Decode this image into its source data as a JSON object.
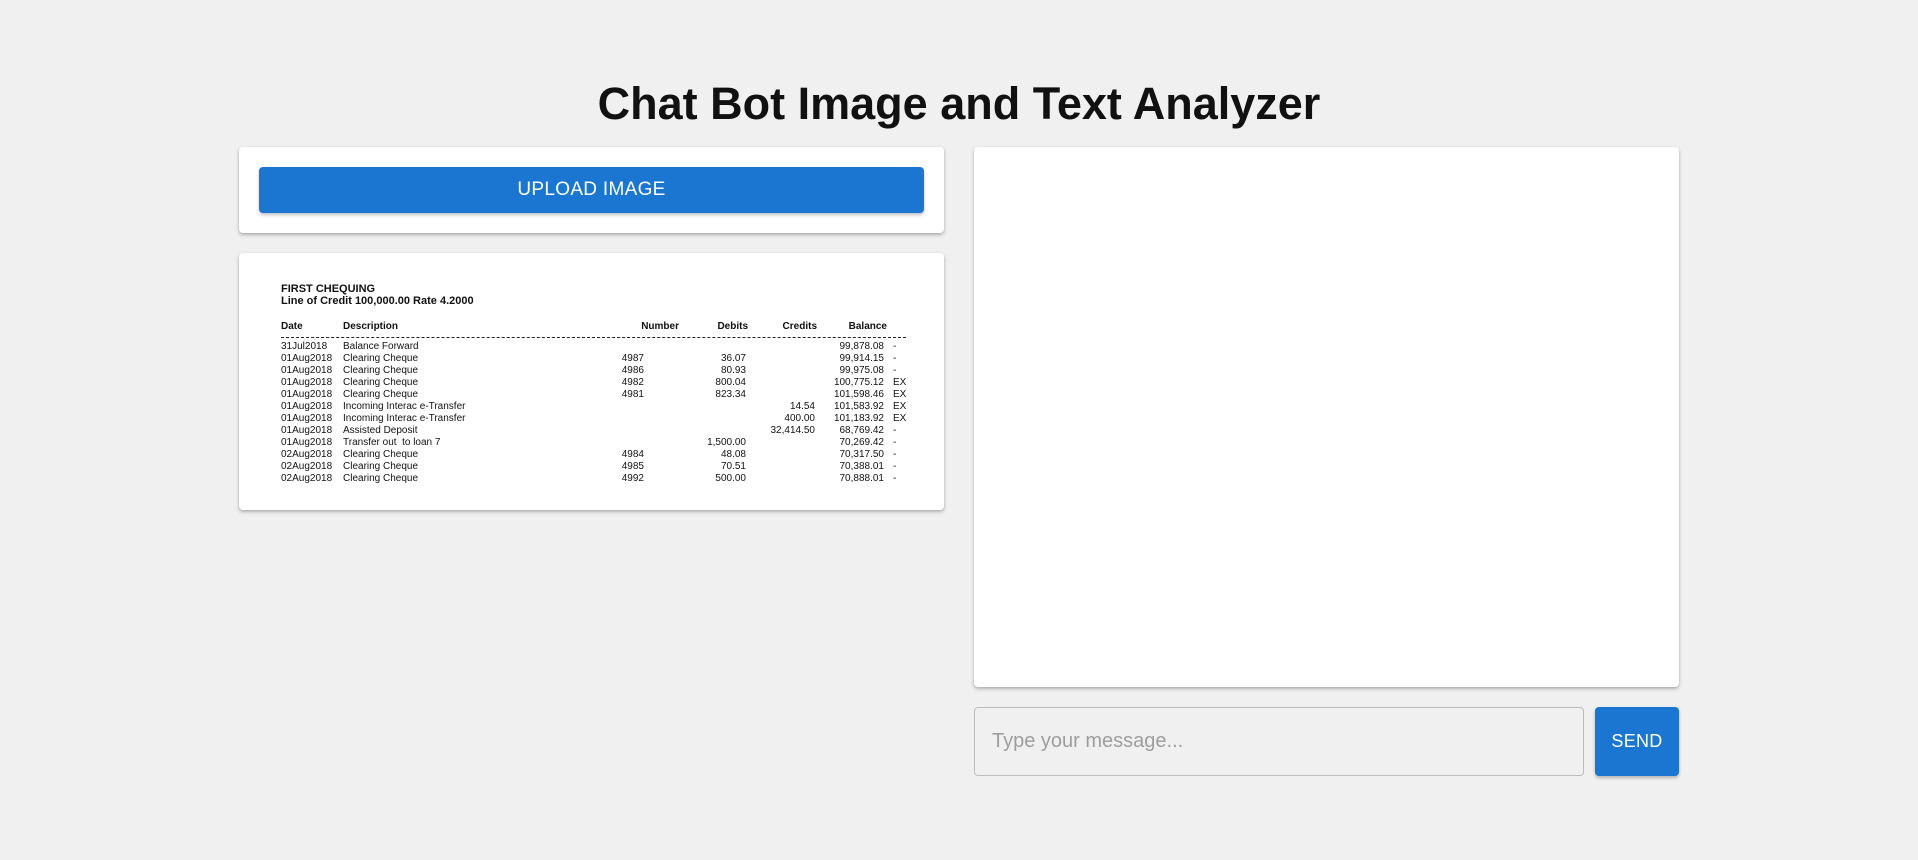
{
  "header": {
    "title": "Chat Bot Image and Text Analyzer"
  },
  "upload": {
    "button_label": "UPLOAD IMAGE"
  },
  "statement": {
    "title": "FIRST CHEQUING",
    "subtitle": "Line of Credit 100,000.00 Rate 4.2000",
    "columns": {
      "date": "Date",
      "description": "Description",
      "number": "Number",
      "debits": "Debits",
      "credits": "Credits",
      "balance": "Balance"
    },
    "rows": [
      {
        "date": "31Jul2018",
        "description": "Balance Forward",
        "number": "",
        "debit": "",
        "credit": "",
        "balance": "99,878.08",
        "flag": "-"
      },
      {
        "date": "01Aug2018",
        "description": "Clearing Cheque",
        "number": "4987",
        "debit": "36.07",
        "credit": "",
        "balance": "99,914.15",
        "flag": "-"
      },
      {
        "date": "01Aug2018",
        "description": "Clearing Cheque",
        "number": "4986",
        "debit": "80.93",
        "credit": "",
        "balance": "99,975.08",
        "flag": "-"
      },
      {
        "date": "01Aug2018",
        "description": "Clearing Cheque",
        "number": "4982",
        "debit": "800.04",
        "credit": "",
        "balance": "100,775.12",
        "flag": "EX"
      },
      {
        "date": "01Aug2018",
        "description": "Clearing Cheque",
        "number": "4981",
        "debit": "823.34",
        "credit": "",
        "balance": "101,598.46",
        "flag": "EX"
      },
      {
        "date": "01Aug2018",
        "description": "Incoming Interac e-Transfer",
        "number": "",
        "debit": "",
        "credit": "14.54",
        "balance": "101,583.92",
        "flag": "EX"
      },
      {
        "date": "01Aug2018",
        "description": "Incoming Interac e-Transfer",
        "number": "",
        "debit": "",
        "credit": "400.00",
        "balance": "101,183.92",
        "flag": "EX"
      },
      {
        "date": "01Aug2018",
        "description": "Assisted Deposit",
        "number": "",
        "debit": "",
        "credit": "32,414.50",
        "balance": "68,769.42",
        "flag": "-"
      },
      {
        "date": "01Aug2018",
        "description": "Transfer out  to loan 7",
        "number": "",
        "debit": "1,500.00",
        "credit": "",
        "balance": "70,269.42",
        "flag": "-"
      },
      {
        "date": "02Aug2018",
        "description": "Clearing Cheque",
        "number": "4984",
        "debit": "48.08",
        "credit": "",
        "balance": "70,317.50",
        "flag": "-"
      },
      {
        "date": "02Aug2018",
        "description": "Clearing Cheque",
        "number": "4985",
        "debit": "70.51",
        "credit": "",
        "balance": "70,388.01",
        "flag": "-"
      },
      {
        "date": "02Aug2018",
        "description": "Clearing Cheque",
        "number": "4992",
        "debit": "500.00",
        "credit": "",
        "balance": "70,888.01",
        "flag": "-"
      }
    ]
  },
  "chat": {
    "input_placeholder": "Type your message...",
    "input_value": "",
    "send_label": "SEND"
  }
}
